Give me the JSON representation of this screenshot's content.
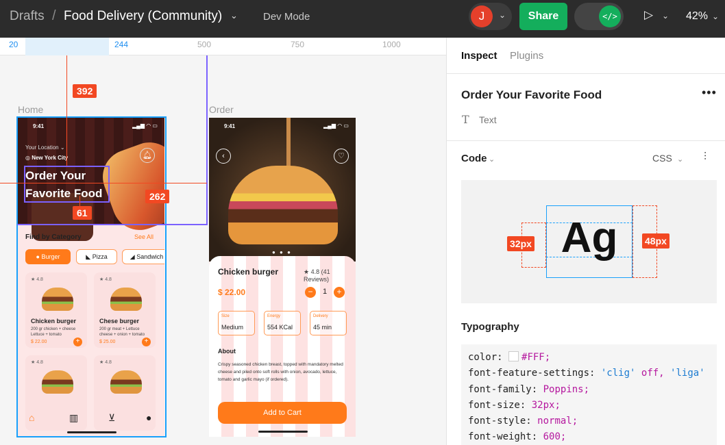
{
  "topbar": {
    "drafts": "Drafts",
    "slash": "/",
    "file_name": "Food Delivery (Community)",
    "dev_mode": "Dev Mode",
    "avatar_letter": "J",
    "share": "Share",
    "zoom": "42%"
  },
  "ruler": {
    "marks": [
      "20",
      "244",
      "500",
      "750",
      "1000"
    ]
  },
  "canvas": {
    "home_label": "Home",
    "order_label": "Order",
    "measure_top": "392",
    "measure_right": "262",
    "measure_bottom": "61"
  },
  "home": {
    "time": "9:41",
    "status_icons": "▂▄▆ ◠ ▭",
    "location_label": "Your Location ⌄",
    "city": "New York City",
    "title": "Order Your Favorite Food",
    "category_title": "Find by Category",
    "see_all": "See All",
    "chips": [
      "Burger",
      "Pizza",
      "Sandwich"
    ],
    "cards": [
      {
        "rating": "★ 4.8",
        "name": "Chicken burger",
        "desc": "200 gr chicken + cheese Lettuce + tomato",
        "price": "$ 22.00"
      },
      {
        "rating": "★ 4.8",
        "name": "Chese burger",
        "desc": "200 gr meat + Lettuce cheese + onion + tomato",
        "price": "$ 25.00"
      },
      {
        "rating": "★ 4.8"
      },
      {
        "rating": "★ 4.8"
      }
    ]
  },
  "order": {
    "time": "9:41",
    "status_icons": "▂▄▆ ◠ ▭",
    "name": "Chicken burger",
    "rating": "★ 4.8 (41 Reviews)",
    "price": "$ 22.00",
    "quantity": "1",
    "specs": [
      {
        "label": "Size",
        "value": "Medium"
      },
      {
        "label": "Energy",
        "value": "554 KCal"
      },
      {
        "label": "Delivery",
        "value": "45 min"
      }
    ],
    "about_title": "About",
    "about_text": "Crispy seasoned chicken breast, topped with mandatory melted cheese and piled onto soft rolls with onion, avocado, lettuce, tomato and garlic mayo (if ordered).",
    "add_to_cart": "Add to Cart"
  },
  "panel": {
    "tabs": [
      "Inspect",
      "Plugins"
    ],
    "layer_title": "Order Your Favorite Food",
    "layer_type": "Text",
    "code_label": "Code",
    "language": "CSS",
    "preview_text": "Ag",
    "line_height_badge": "32px",
    "box_height_badge": "48px",
    "typography_label": "Typography",
    "css": {
      "color_prop": "color:",
      "color_val": "#FFF;",
      "ffs_prop": "font-feature-settings:",
      "ffs_val1": "'clig'",
      "ffs_off": "off,",
      "ffs_val2": "'liga'",
      "family_prop": "font-family:",
      "family_val": "Poppins;",
      "size_prop": "font-size:",
      "size_val": "32px;",
      "style_prop": "font-style:",
      "style_val": "normal;",
      "weight_prop": "font-weight:",
      "weight_val": "600;"
    }
  },
  "colors": {
    "accent_orange": "#ff7a1a",
    "figma_green": "#14ae5c",
    "measure_red": "#f24822",
    "selection_blue": "#18a0fb"
  }
}
